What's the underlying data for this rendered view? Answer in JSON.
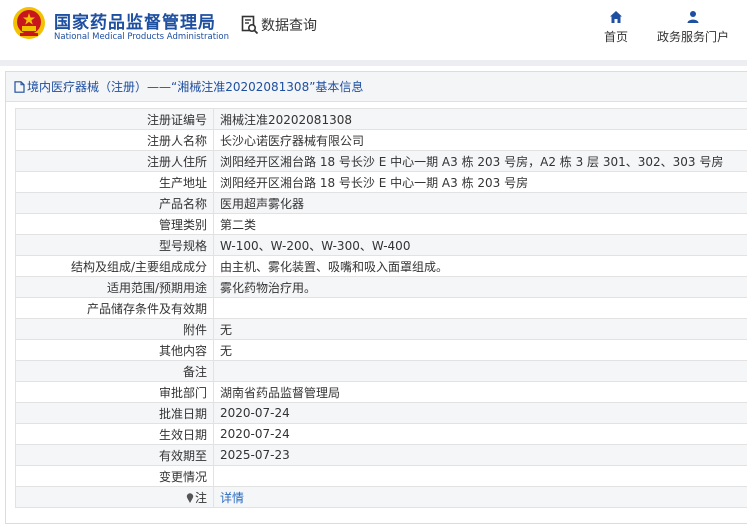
{
  "header": {
    "brand_cn": "国家药品监督管理局",
    "brand_en": "National Medical Products Administration",
    "search_label": "数据查询",
    "nav": [
      {
        "label": "首页",
        "icon": "home-icon"
      },
      {
        "label": "政务服务门户",
        "icon": "user-icon"
      }
    ]
  },
  "panel": {
    "title": "境内医疗器械（注册）——“湘械注准20202081308”基本信息"
  },
  "rows": [
    {
      "label": "注册证编号",
      "value": "湘械注准20202081308"
    },
    {
      "label": "注册人名称",
      "value": "长沙心诺医疗器械有限公司"
    },
    {
      "label": "注册人住所",
      "value": "浏阳经开区湘台路 18 号长沙 E 中心一期 A3 栋 203 号房，A2 栋 3 层 301、302、303 号房"
    },
    {
      "label": "生产地址",
      "value": "浏阳经开区湘台路 18 号长沙 E 中心一期 A3 栋 203 号房"
    },
    {
      "label": "产品名称",
      "value": "医用超声雾化器"
    },
    {
      "label": "管理类别",
      "value": "第二类"
    },
    {
      "label": "型号规格",
      "value": "W-100、W-200、W-300、W-400"
    },
    {
      "label": "结构及组成/主要组成成分",
      "value": "由主机、雾化装置、吸嘴和吸入面罩组成。"
    },
    {
      "label": "适用范围/预期用途",
      "value": "雾化药物治疗用。"
    },
    {
      "label": "产品储存条件及有效期",
      "value": ""
    },
    {
      "label": "附件",
      "value": "无"
    },
    {
      "label": "其他内容",
      "value": "无"
    },
    {
      "label": "备注",
      "value": ""
    },
    {
      "label": "审批部门",
      "value": "湖南省药品监督管理局"
    },
    {
      "label": "批准日期",
      "value": "2020-07-24"
    },
    {
      "label": "生效日期",
      "value": "2020-07-24"
    },
    {
      "label": "有效期至",
      "value": "2025-07-23"
    },
    {
      "label": "变更情况",
      "value": ""
    },
    {
      "label": "注",
      "value": "详情",
      "icon": "pin-icon"
    }
  ],
  "colors": {
    "brand_blue": "#1e4fa0",
    "link_blue": "#2a6bc1",
    "emblem_red": "#c8161d",
    "emblem_gold": "#f2c200"
  }
}
